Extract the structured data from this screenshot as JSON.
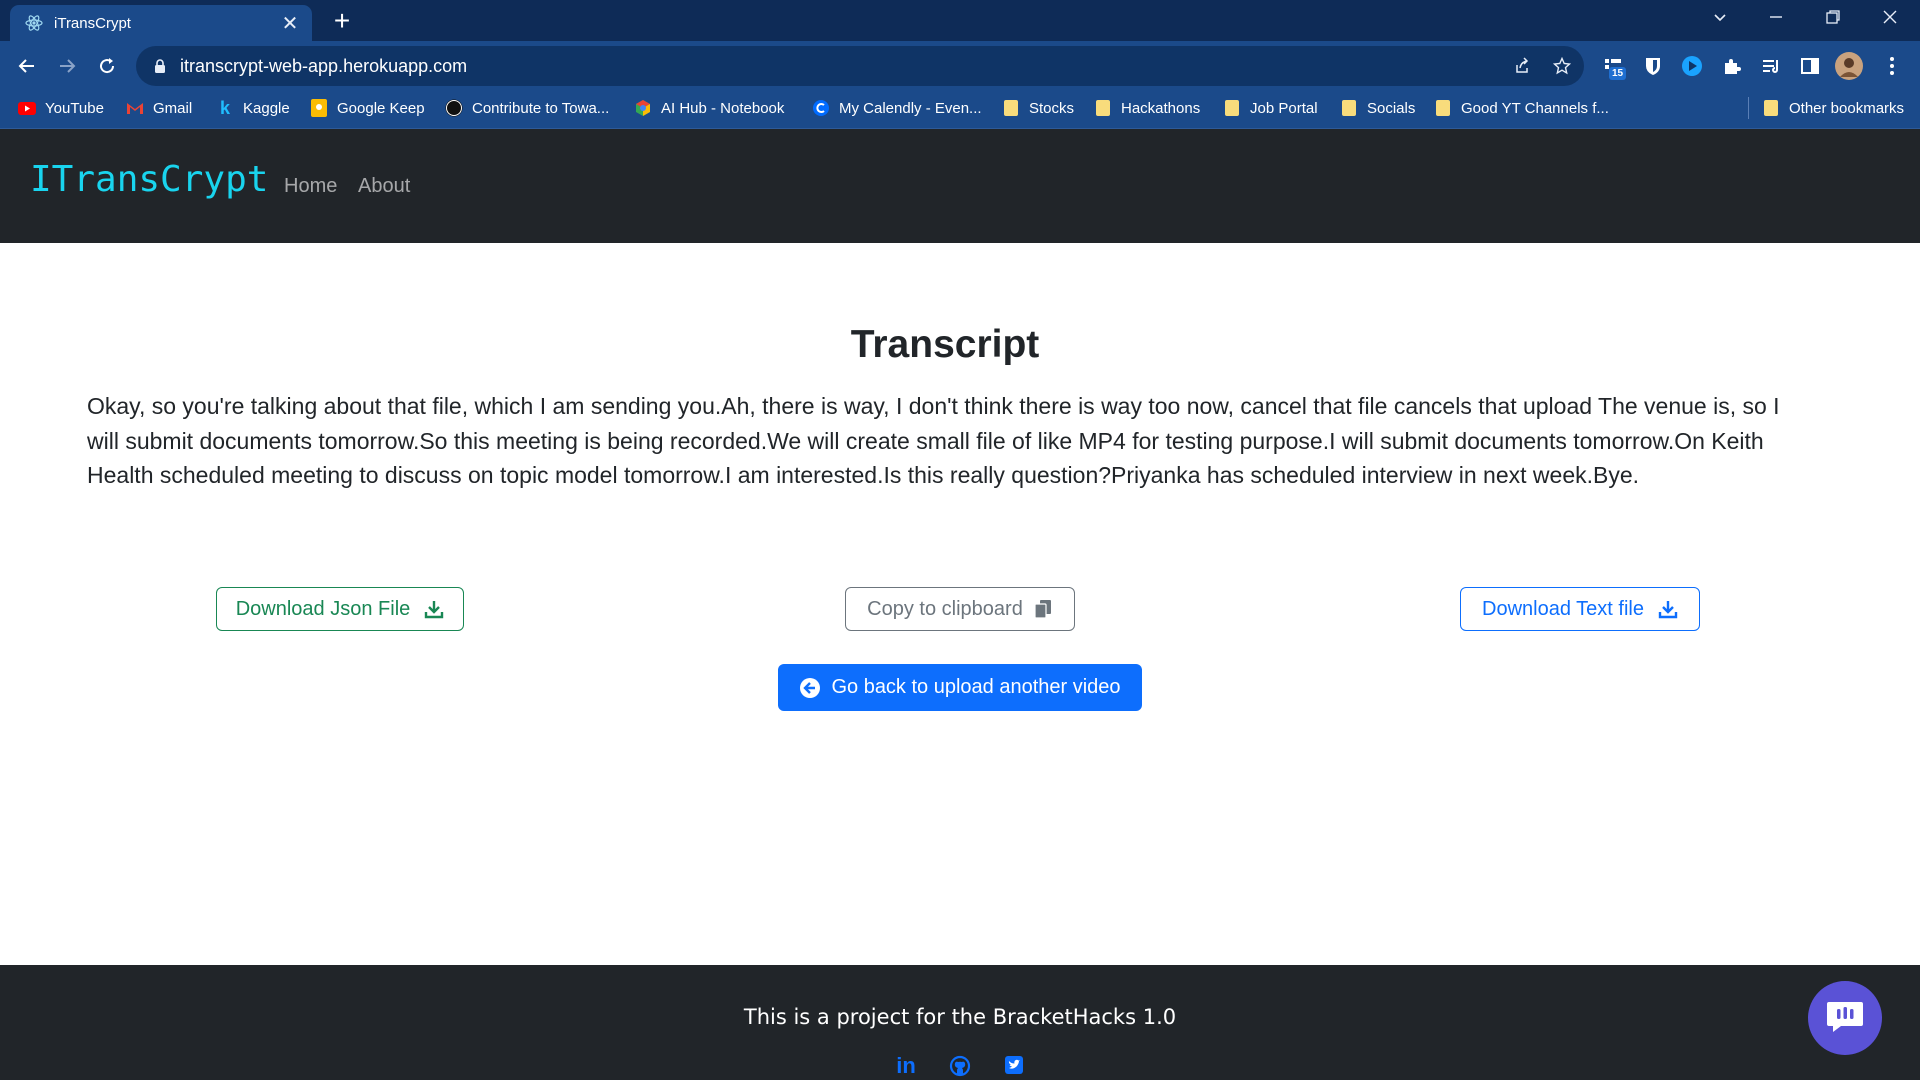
{
  "browser": {
    "tab_title": "iTransCrypt",
    "url": "itranscrypt-web-app.herokuapp.com",
    "extension_badge": "15",
    "bookmarks": [
      {
        "label": "YouTube",
        "icon": "youtube-icon"
      },
      {
        "label": "Gmail",
        "icon": "gmail-icon"
      },
      {
        "label": "Kaggle",
        "icon": "kaggle-icon"
      },
      {
        "label": "Google Keep",
        "icon": "keep-icon"
      },
      {
        "label": "Contribute to Towa...",
        "icon": "medium-icon"
      },
      {
        "label": "AI Hub - Notebook",
        "icon": "aihub-icon"
      },
      {
        "label": "My Calendly - Even...",
        "icon": "calendly-icon"
      },
      {
        "label": "Stocks",
        "icon": "folder-icon"
      },
      {
        "label": "Hackathons",
        "icon": "folder-icon"
      },
      {
        "label": "Job Portal",
        "icon": "folder-icon"
      },
      {
        "label": "Socials",
        "icon": "folder-icon"
      },
      {
        "label": "Good YT Channels f...",
        "icon": "folder-icon"
      }
    ],
    "other_bookmarks": "Other bookmarks"
  },
  "site": {
    "brand": "ITransCrypt",
    "nav": [
      "Home",
      "About"
    ]
  },
  "main": {
    "title": "Transcript",
    "transcript": "Okay, so you're talking about that file, which I am sending you.Ah, there is way, I don't think there is way too now, cancel that file cancels that upload The venue is, so I will submit documents tomorrow.So this meeting is being recorded.We will create small file of like MP4 for testing purpose.I will submit documents tomorrow.On Keith Health scheduled meeting to discuss on topic model tomorrow.I am interested.Is this really question?Priyanka has scheduled interview in next week.Bye.",
    "buttons": {
      "download_json": "Download Json File",
      "copy_clipboard": "Copy to clipboard",
      "download_text": "Download Text file",
      "go_back": "Go back to upload another video"
    }
  },
  "footer": {
    "text": "This is a project for the BracketHacks 1.0",
    "socials": [
      "linkedin-icon",
      "github-icon",
      "twitter-icon"
    ]
  },
  "colors": {
    "navbar_bg": "#212529",
    "brand": "#19d4ee",
    "success": "#198754",
    "secondary": "#6c757d",
    "primary": "#0d6efd",
    "chat_bubble": "#5a52d6"
  }
}
